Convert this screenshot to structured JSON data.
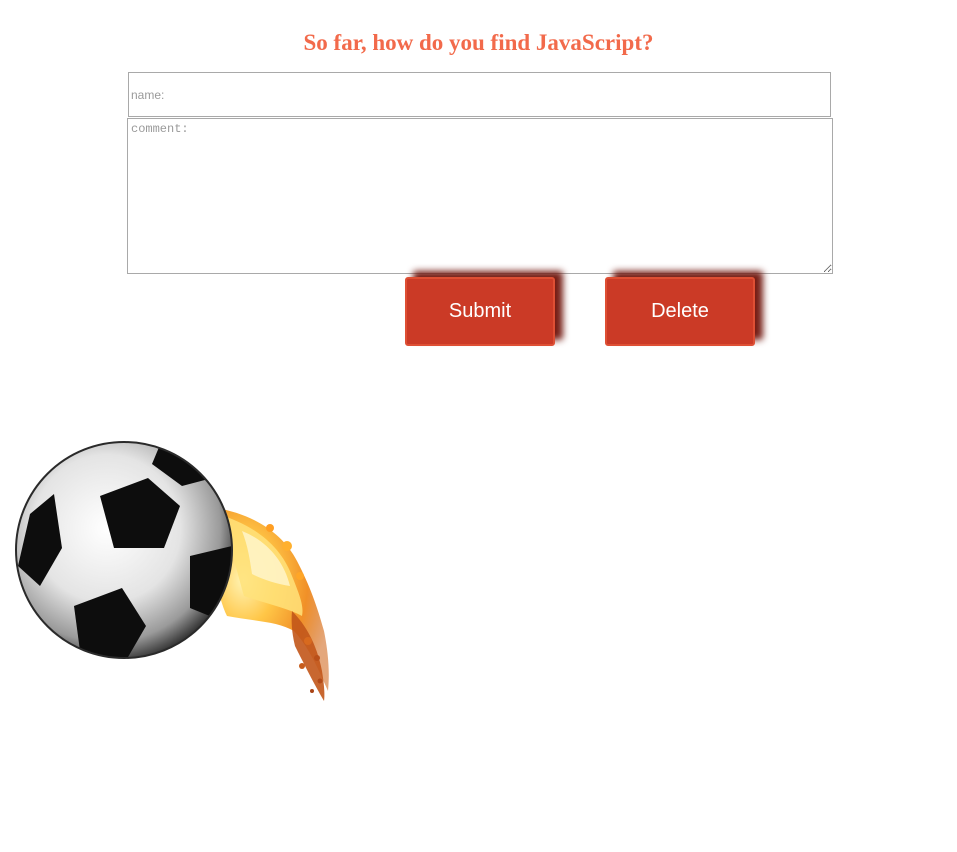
{
  "page": {
    "title": "So far, how do you find JavaScript?"
  },
  "form": {
    "name_placeholder": "name:",
    "name_value": "",
    "comment_placeholder": "comment:",
    "comment_value": "",
    "submit_label": "Submit",
    "delete_label": "Delete"
  },
  "image": {
    "name": "flaming-soccer-ball-icon"
  },
  "colors": {
    "title": "#f26a4b",
    "button": "#cb3a26",
    "button_shadow": "#6e120a"
  }
}
